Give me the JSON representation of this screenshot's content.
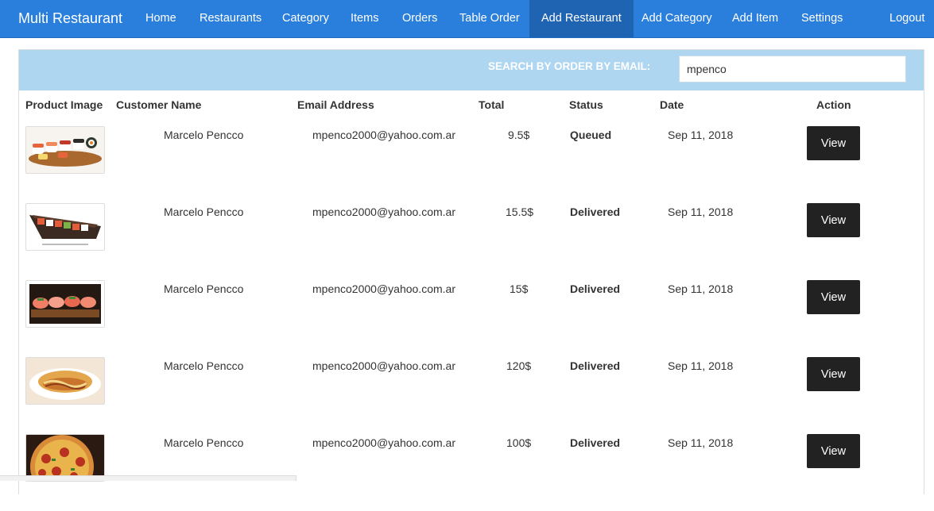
{
  "navbar": {
    "brand": "Multi Restaurant",
    "items": [
      {
        "label": "Home"
      },
      {
        "label": "Restaurants"
      },
      {
        "label": "Category"
      },
      {
        "label": "Items"
      },
      {
        "label": "Orders"
      },
      {
        "label": "Table Order"
      },
      {
        "label": "Add Restaurant",
        "active": true
      },
      {
        "label": "Add Category"
      },
      {
        "label": "Add Item"
      },
      {
        "label": "Settings"
      },
      {
        "label": "Logout"
      }
    ]
  },
  "search": {
    "label": "SEARCH BY ORDER BY EMAIL:",
    "value": "mpenco"
  },
  "table": {
    "headers": [
      "Product Image",
      "Customer Name",
      "Email Address",
      "Total",
      "Status",
      "Date",
      "Action"
    ],
    "rows": [
      {
        "customer": "Marcelo Pencco",
        "email": "mpenco2000@yahoo.com.ar",
        "total": "9.5$",
        "status": "Queued",
        "date": "Sep 11, 2018",
        "action": "View"
      },
      {
        "customer": "Marcelo Pencco",
        "email": "mpenco2000@yahoo.com.ar",
        "total": "15.5$",
        "status": "Delivered",
        "date": "Sep 11, 2018",
        "action": "View"
      },
      {
        "customer": "Marcelo Pencco",
        "email": "mpenco2000@yahoo.com.ar",
        "total": "15$",
        "status": "Delivered",
        "date": "Sep 11, 2018",
        "action": "View"
      },
      {
        "customer": "Marcelo Pencco",
        "email": "mpenco2000@yahoo.com.ar",
        "total": "120$",
        "status": "Delivered",
        "date": "Sep 11, 2018",
        "action": "View"
      },
      {
        "customer": "Marcelo Pencco",
        "email": "mpenco2000@yahoo.com.ar",
        "total": "100$",
        "status": "Delivered",
        "date": "Sep 11, 2018",
        "action": "View"
      }
    ]
  },
  "colors": {
    "navbar": "#2b7fdc",
    "navbar_active": "#1f63b3",
    "search_bar": "#aed6f1",
    "button": "#222222"
  }
}
